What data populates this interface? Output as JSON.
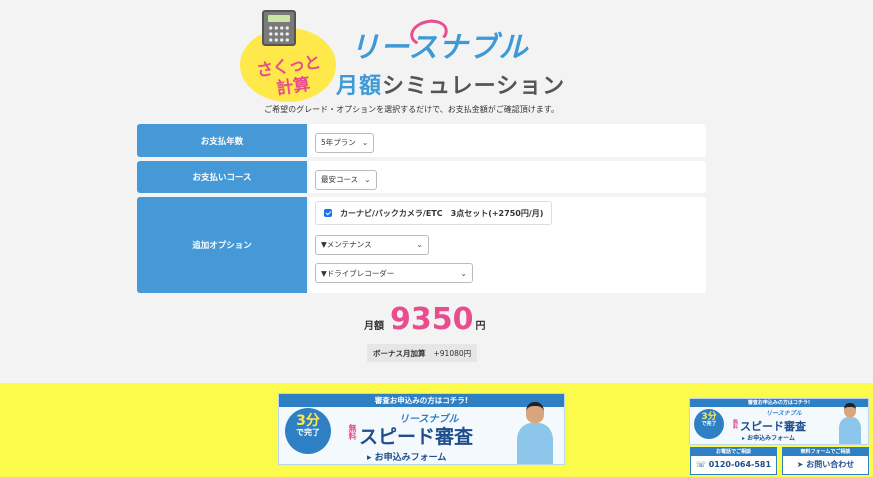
{
  "header": {
    "bubble_line1": "さくっと",
    "bubble_line2": "計算",
    "brand": "リースナブル",
    "title_blue": "月額",
    "title_dark": "シミュレーション",
    "intro": "ご希望のグレード・オプションを選択するだけで、お支払金額がご確認頂けます。"
  },
  "form": {
    "rows": [
      {
        "label": "お支払年数",
        "select": "5年プラン"
      },
      {
        "label": "お支払いコース",
        "select": "最安コース"
      },
      {
        "label": "追加オプション"
      }
    ],
    "option_checkbox": "カーナビ/バックカメラ/ETC　3点セット(+2750円/月)",
    "option_checked": true,
    "maintenance_select": "▼メンテナンス",
    "recorder_select": "▼ドライブレコーダー"
  },
  "result": {
    "label": "月額",
    "value": "9350",
    "unit": "円",
    "bonus_label": "ボーナス月加算",
    "bonus_value": "+91080円"
  },
  "footer": {
    "banner": {
      "top": "審査お申込みの方はコチラ!",
      "badge_num": "3分",
      "badge_text": "で完了",
      "brand": "リースナブル",
      "free": "無料",
      "main": "スピード審査",
      "form": "▸ お申込みフォーム"
    },
    "tel": {
      "top": "お電話でご相談",
      "main": "0120-064-581"
    },
    "mail": {
      "top": "無料フォームでご相談",
      "main": "お問い合わせ"
    }
  },
  "colors": {
    "accent_blue": "#4599d7",
    "accent_pink": "#e94d8f",
    "footer_yellow": "#fcfa4a"
  }
}
